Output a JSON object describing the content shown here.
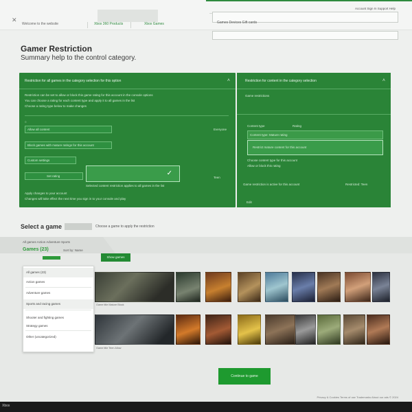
{
  "top": {
    "links": [
      "Welcome to the website",
      "Xbox 360 Products",
      "Xbox Games"
    ],
    "account": "Account  Sign In  Support  Help",
    "search_value": "",
    "search_hint": "Games  Devices  Gift cards"
  },
  "hero": {
    "title": "Gamer Restriction",
    "subtitle": "Summary help to the control category."
  },
  "panel_left": {
    "header": "Restriction for all games in the category selection for this option",
    "lines": [
      "Restriction can be set to allow or block this game rating for this account in the console options",
      "You can choose a rating for each content type and apply it to all games in the list",
      "Choose a rating type below to make changes"
    ],
    "options": [
      {
        "label": "Allow all content",
        "right": "Everyone"
      },
      {
        "label": "Block games with mature ratings for this account",
        "right": ""
      },
      {
        "label": "Custom settings",
        "right": ""
      },
      {
        "label": "Set rating",
        "right": "Teen"
      }
    ],
    "selected_note": "Selected content restriction applies to all games in the list",
    "footer": [
      "Apply changes to your account",
      "Changes will take effect the next time you sign in to your console and play"
    ]
  },
  "panel_right": {
    "header": "Restriction for content in the category selection",
    "sub": "Game restrictions",
    "label_a": "Content type",
    "label_b": "Rating",
    "selected_header": "Content type: Mature rating",
    "selected_value": "Restrict mature content for this account",
    "notes": [
      "Choose content type for this account",
      "Allow or block this rating"
    ],
    "status_left": "Game restriction is active for this account",
    "status_right": "Restricted: Teen",
    "footer_link": "Edit"
  },
  "select": {
    "title": "Select a game",
    "hint": "Choose a game to apply the restriction",
    "filters": [
      "All games  Action  Adventure  Sports",
      "Sort by: Name"
    ],
    "green_label": "Games (23)",
    "button": "Show games"
  },
  "dropdown": {
    "items": [
      "All games (23)",
      "Action games",
      "Adventure games",
      "Sports and racing games",
      "Shooter and fighting games",
      "Strategy games",
      "Other (uncategorized)"
    ]
  },
  "tiles": {
    "row1_caption": "Game title  Mature  Block",
    "row2_caption": "Game title  Teen  Allow"
  },
  "cta": {
    "label": "Continue to game"
  },
  "footer": {
    "legal": "Privacy & Cookies   Terms of use   Trademarks   About our ads   © 2024",
    "brand": "Xbox"
  },
  "colors": {
    "panel_green": "#2a8437",
    "accent_green": "#1e9a2f",
    "footer_black": "#1a1a1a"
  }
}
